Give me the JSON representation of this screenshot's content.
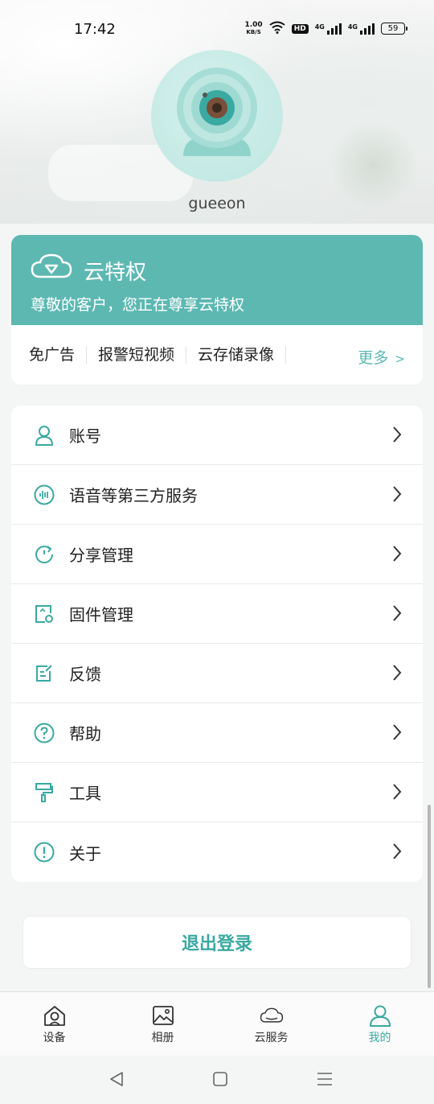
{
  "status_bar": {
    "time": "17:42",
    "net_speed_value": "1.00",
    "net_speed_unit": "KB/S",
    "hd_label": "HD",
    "sig1_label": "4G",
    "sig2_label": "4G",
    "battery": "59"
  },
  "profile": {
    "username": "gueeon"
  },
  "cloud": {
    "title": "云特权",
    "subtitle": "尊敬的客户，您正在尊享云特权",
    "features": [
      "免广告",
      "报警短视频",
      "云存储录像"
    ],
    "more_label": "更多",
    "more_chevron": ">"
  },
  "menu": {
    "items": [
      {
        "label": "账号",
        "icon": "user-icon"
      },
      {
        "label": "语音等第三方服务",
        "icon": "voice-icon"
      },
      {
        "label": "分享管理",
        "icon": "share-icon"
      },
      {
        "label": "固件管理",
        "icon": "firmware-icon"
      },
      {
        "label": "反馈",
        "icon": "feedback-icon"
      },
      {
        "label": "帮助",
        "icon": "help-icon"
      },
      {
        "label": "工具",
        "icon": "tool-icon"
      },
      {
        "label": "关于",
        "icon": "about-icon"
      }
    ]
  },
  "logout_label": "退出登录",
  "bottom_nav": {
    "items": [
      {
        "label": "设备",
        "icon": "home-icon",
        "active": false
      },
      {
        "label": "相册",
        "icon": "album-icon",
        "active": false
      },
      {
        "label": "云服务",
        "icon": "cloud-icon",
        "active": false
      },
      {
        "label": "我的",
        "icon": "person-icon",
        "active": true
      }
    ]
  },
  "colors": {
    "accent": "#5db8b2",
    "accent_text": "#3aa9a1"
  }
}
